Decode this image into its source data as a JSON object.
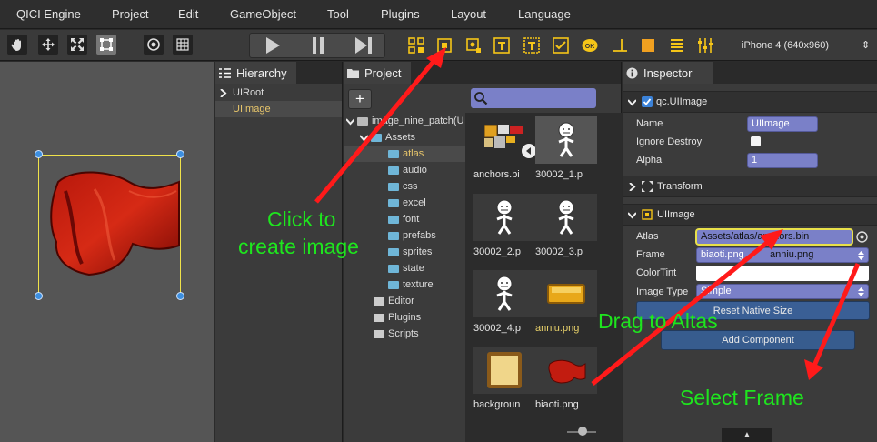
{
  "menu": [
    "QICI Engine",
    "Project",
    "Edit",
    "GameObject",
    "Tool",
    "Plugins",
    "Layout",
    "Language"
  ],
  "toolbar": {
    "device": "iPhone 4 (640x960)",
    "device_arrow": "⇕"
  },
  "hierarchy": {
    "tab_label": "Hierarchy",
    "items": [
      "UIRoot",
      "UIImage"
    ]
  },
  "project": {
    "tab_label": "Project",
    "add_label": "+",
    "tree": [
      "image_nine_patch(U",
      "Assets",
      "atlas",
      "audio",
      "css",
      "excel",
      "font",
      "prefabs",
      "sprites",
      "state",
      "texture",
      "Editor",
      "Plugins",
      "Scripts"
    ],
    "files": [
      "anchors.bi",
      "30002_1.p",
      "30002_2.p",
      "30002_3.p",
      "30002_4.p",
      "anniu.png",
      "backgroun",
      "biaoti.png"
    ]
  },
  "inspector": {
    "tab_label": "Inspector",
    "node_section": "qc.UIImage",
    "name_label": "Name",
    "name_value": "UIImage",
    "ignore_destroy_label": "Ignore Destroy",
    "alpha_label": "Alpha",
    "alpha_value": "1",
    "transform_section": "Transform",
    "image_section": "UIImage",
    "atlas_label": "Atlas",
    "atlas_value": "Assets/atlas/anchors.bin",
    "frame_label": "Frame",
    "frame_value": "biaoti.png",
    "frame_overlay": "anniu.png",
    "colortint_label": "ColorTint",
    "image_type_label": "Image Type",
    "image_type_value": "Simple",
    "reset_label": "Reset Native Size",
    "add_component_label": "Add Component",
    "bottom_tab": "▲"
  },
  "annotations": {
    "click_line1": "Click to",
    "click_line2": "create image",
    "drag": "Drag to Altas",
    "select": "Select Frame"
  },
  "colors": {
    "annotation_text": "#1ee61e",
    "arrow": "#ff1a1a",
    "selection": "#e8c66b",
    "field_purple": "#7a80c8",
    "toolbar_yellow": "#f5c518"
  }
}
